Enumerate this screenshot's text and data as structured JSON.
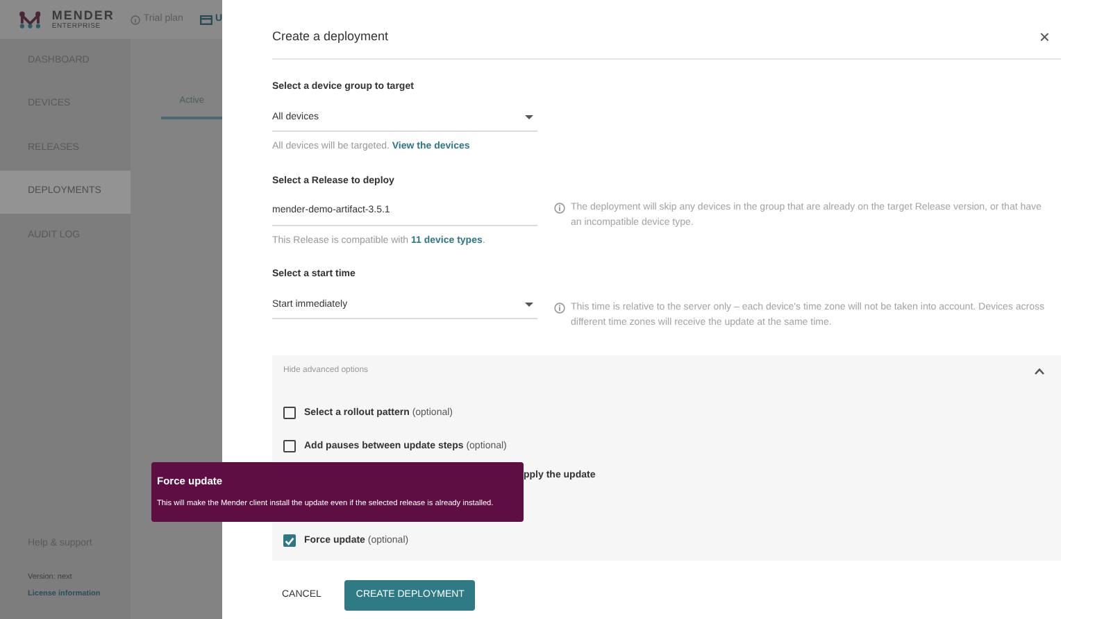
{
  "header": {
    "logo_text": "MENDER",
    "logo_subtext": "ENTERPRISE",
    "plan": "Trial plan",
    "cut_item": "U"
  },
  "sidebar": {
    "items": [
      {
        "label": "DASHBOARD",
        "selected": false
      },
      {
        "label": "DEVICES",
        "selected": false
      },
      {
        "label": "RELEASES",
        "selected": false
      },
      {
        "label": "DEPLOYMENTS",
        "selected": true
      },
      {
        "label": "AUDIT LOG",
        "selected": false
      }
    ],
    "help": "Help & support",
    "version": "Version: next",
    "license": "License information"
  },
  "tabs": [
    {
      "label": "Active",
      "selected": true
    }
  ],
  "dialog": {
    "title": "Create a deployment",
    "close": "×",
    "sections": [
      {
        "heading": "Select a device group to target",
        "value": "All devices",
        "kind": "select",
        "hint": "All devices will be targeted.",
        "hint_link": "View the devices"
      },
      {
        "heading": "Select a Release to deploy",
        "value": "mender-demo-artifact-3.5.1",
        "kind": "text",
        "hint": "This Release is compatible with",
        "hint_link": "11 device types",
        "hint_after": ".",
        "info": "The deployment will skip any devices in the group that are already on the target Release version, or that have an incompatible device type."
      },
      {
        "heading": "Select a start time",
        "value": "Start immediately",
        "kind": "select",
        "info": "This time is relative to the server only – each device's time zone will not be taken into account. Devices across different time zones will receive the update at the same time."
      }
    ],
    "advanced": {
      "toggle": "Hide advanced options",
      "expanded": true,
      "options": [
        {
          "kind": "checkbox",
          "label": "Select a rollout pattern",
          "suffix": "(optional)",
          "checked": false
        },
        {
          "kind": "checkbox",
          "label": "Add pauses between update steps",
          "suffix": "(optional)",
          "checked": false
        },
        {
          "kind": "partial",
          "label": "pply the update"
        },
        {
          "kind": "checkbox",
          "label": "Force update",
          "suffix": "(optional)",
          "checked": true
        }
      ]
    },
    "buttons": {
      "cancel": "CANCEL",
      "create": "CREATE DEPLOYMENT"
    }
  },
  "tooltip": {
    "title": "Force update",
    "text": "This will make the Mender client install the update even if the selected release is already installed."
  }
}
